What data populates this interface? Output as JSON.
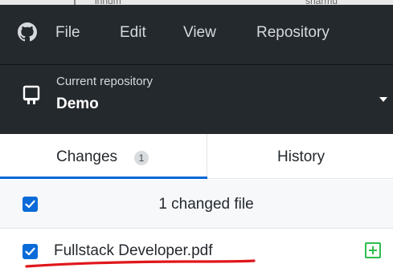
{
  "menubar": {
    "top_strip_text_left": "innum",
    "top_strip_text_right": "sharmu",
    "items": [
      "File",
      "Edit",
      "View",
      "Repository"
    ]
  },
  "repo": {
    "label": "Current repository",
    "name": "Demo"
  },
  "tabs": {
    "changes_label": "Changes",
    "changes_count": "1",
    "history_label": "History"
  },
  "changes": {
    "header_text": "1 changed file",
    "files": [
      {
        "name": "Fullstack Developer.pdf",
        "status": "added",
        "checked": true
      }
    ]
  },
  "colors": {
    "toolbar_bg": "#24292e",
    "accent_blue": "#0366d6",
    "added_green": "#2cbe4e",
    "annotation_red": "#e0161a"
  }
}
